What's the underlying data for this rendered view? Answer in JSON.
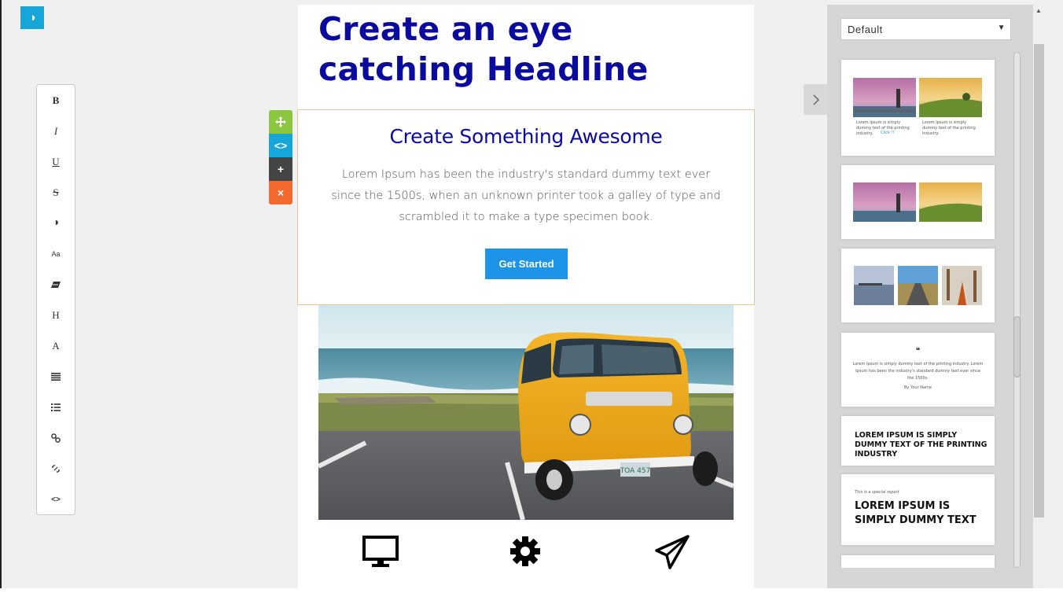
{
  "editor": {
    "theme_toggle_icon": "contrast-icon",
    "toolbar": [
      {
        "name": "bold",
        "glyph": "B"
      },
      {
        "name": "italic",
        "glyph": "I"
      },
      {
        "name": "underline",
        "glyph": "U"
      },
      {
        "name": "strikethrough",
        "glyph": "S"
      },
      {
        "name": "color",
        "glyph": "◑"
      },
      {
        "name": "font-size",
        "glyph": "Aa"
      },
      {
        "name": "clear-format",
        "glyph": "⌫"
      },
      {
        "name": "heading",
        "glyph": "H"
      },
      {
        "name": "font",
        "glyph": "A"
      },
      {
        "name": "align",
        "glyph": "≡"
      },
      {
        "name": "list",
        "glyph": "☰"
      },
      {
        "name": "link",
        "glyph": "🔗"
      },
      {
        "name": "unlink",
        "glyph": "⛓"
      },
      {
        "name": "source",
        "glyph": "<>"
      }
    ],
    "block_controls": {
      "move": "✥",
      "code": "<>",
      "add": "+",
      "delete": "×"
    }
  },
  "canvas": {
    "headline": "Create an eye catching Headline",
    "block": {
      "title": "Create Something Awesome",
      "body": "Lorem Ipsum has been the industry's standard dummy text ever since the 1500s, when an unknown printer took a galley of type and scrambled it to make a type specimen book.",
      "cta_label": "Get Started"
    },
    "photo_plate": "TOA 457",
    "feature_icons": [
      "monitor-icon",
      "gear-icon",
      "paper-plane-icon"
    ]
  },
  "side_panel": {
    "select_value": "Default",
    "cards": [
      {
        "type": "two-images-text",
        "text": "Lorem Ipsum is simply dummy text of the printing industry.",
        "link": "Click !!"
      },
      {
        "type": "two-images"
      },
      {
        "type": "three-images"
      },
      {
        "type": "quote",
        "quote_mark": "❝",
        "text": "Lorem Ipsum is simply dummy text of the printing industry. Lorem Ipsum has been the industry's standard dummy text ever since the 1500s.",
        "author": "By Your Name"
      },
      {
        "type": "caps-heading",
        "text": "LOREM IPSUM IS SIMPLY DUMMY TEXT OF THE PRINTING INDUSTRY"
      },
      {
        "type": "special-report",
        "kicker": "This is a special report",
        "text": "LOREM IPSUM IS SIMPLY DUMMY TEXT"
      }
    ]
  },
  "colors": {
    "headline": "#0a0a9e",
    "cta": "#1d94e8",
    "accent_blue": "#17a6d8",
    "accent_green": "#8cc63f",
    "accent_orange": "#f36a2e"
  }
}
